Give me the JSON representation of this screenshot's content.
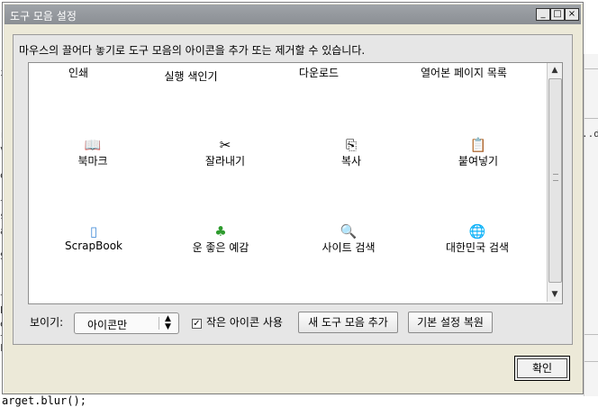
{
  "background": {
    "left_chars": [
      "i",
      "r",
      "v",
      "e",
      "t",
      "s",
      "a",
      "S",
      "t",
      "b",
      "e",
      "t",
      "F"
    ],
    "right_text": "..d",
    "bottom_code": "arget.blur();"
  },
  "window": {
    "title": "도구 모음 설정",
    "minimize": "_",
    "maximize": "□",
    "close": "×"
  },
  "description": "마우스의 끌어다 놓기로 도구 모음의 아이콘을 추가 또는 제거할 수 있습니다.",
  "toolbar_items": [
    {
      "label": "인쇄",
      "icon": ""
    },
    {
      "label": "실행 색인기",
      "icon": ""
    },
    {
      "label": "다운로드",
      "icon": ""
    },
    {
      "label": "열어본 페이지 목록",
      "icon": ""
    },
    {
      "label": "북마크",
      "icon": "book-icon",
      "glyph": "📖"
    },
    {
      "label": "잘라내기",
      "icon": "scissors-icon",
      "glyph": "✂"
    },
    {
      "label": "복사",
      "icon": "copy-icon",
      "glyph": "⎘"
    },
    {
      "label": "붙여넣기",
      "icon": "paste-icon",
      "glyph": "📋"
    },
    {
      "label": "ScrapBook",
      "icon": "scrapbook-icon",
      "glyph": "▯"
    },
    {
      "label": "운 좋은 예감",
      "icon": "clover-icon",
      "glyph": "♣"
    },
    {
      "label": "사이트 검색",
      "icon": "search-site-icon",
      "glyph": "🔍"
    },
    {
      "label": "대한민국 검색",
      "icon": "globe-icon",
      "glyph": "🌐"
    }
  ],
  "controls": {
    "show_label": "보이기:",
    "show_value": "아이콘만",
    "small_icons_label": "작은 아이콘 사용",
    "small_icons_checked": true,
    "add_toolbar": "새 도구 모음 추가",
    "restore_default": "기본 설정 복원",
    "ok": "확인"
  }
}
